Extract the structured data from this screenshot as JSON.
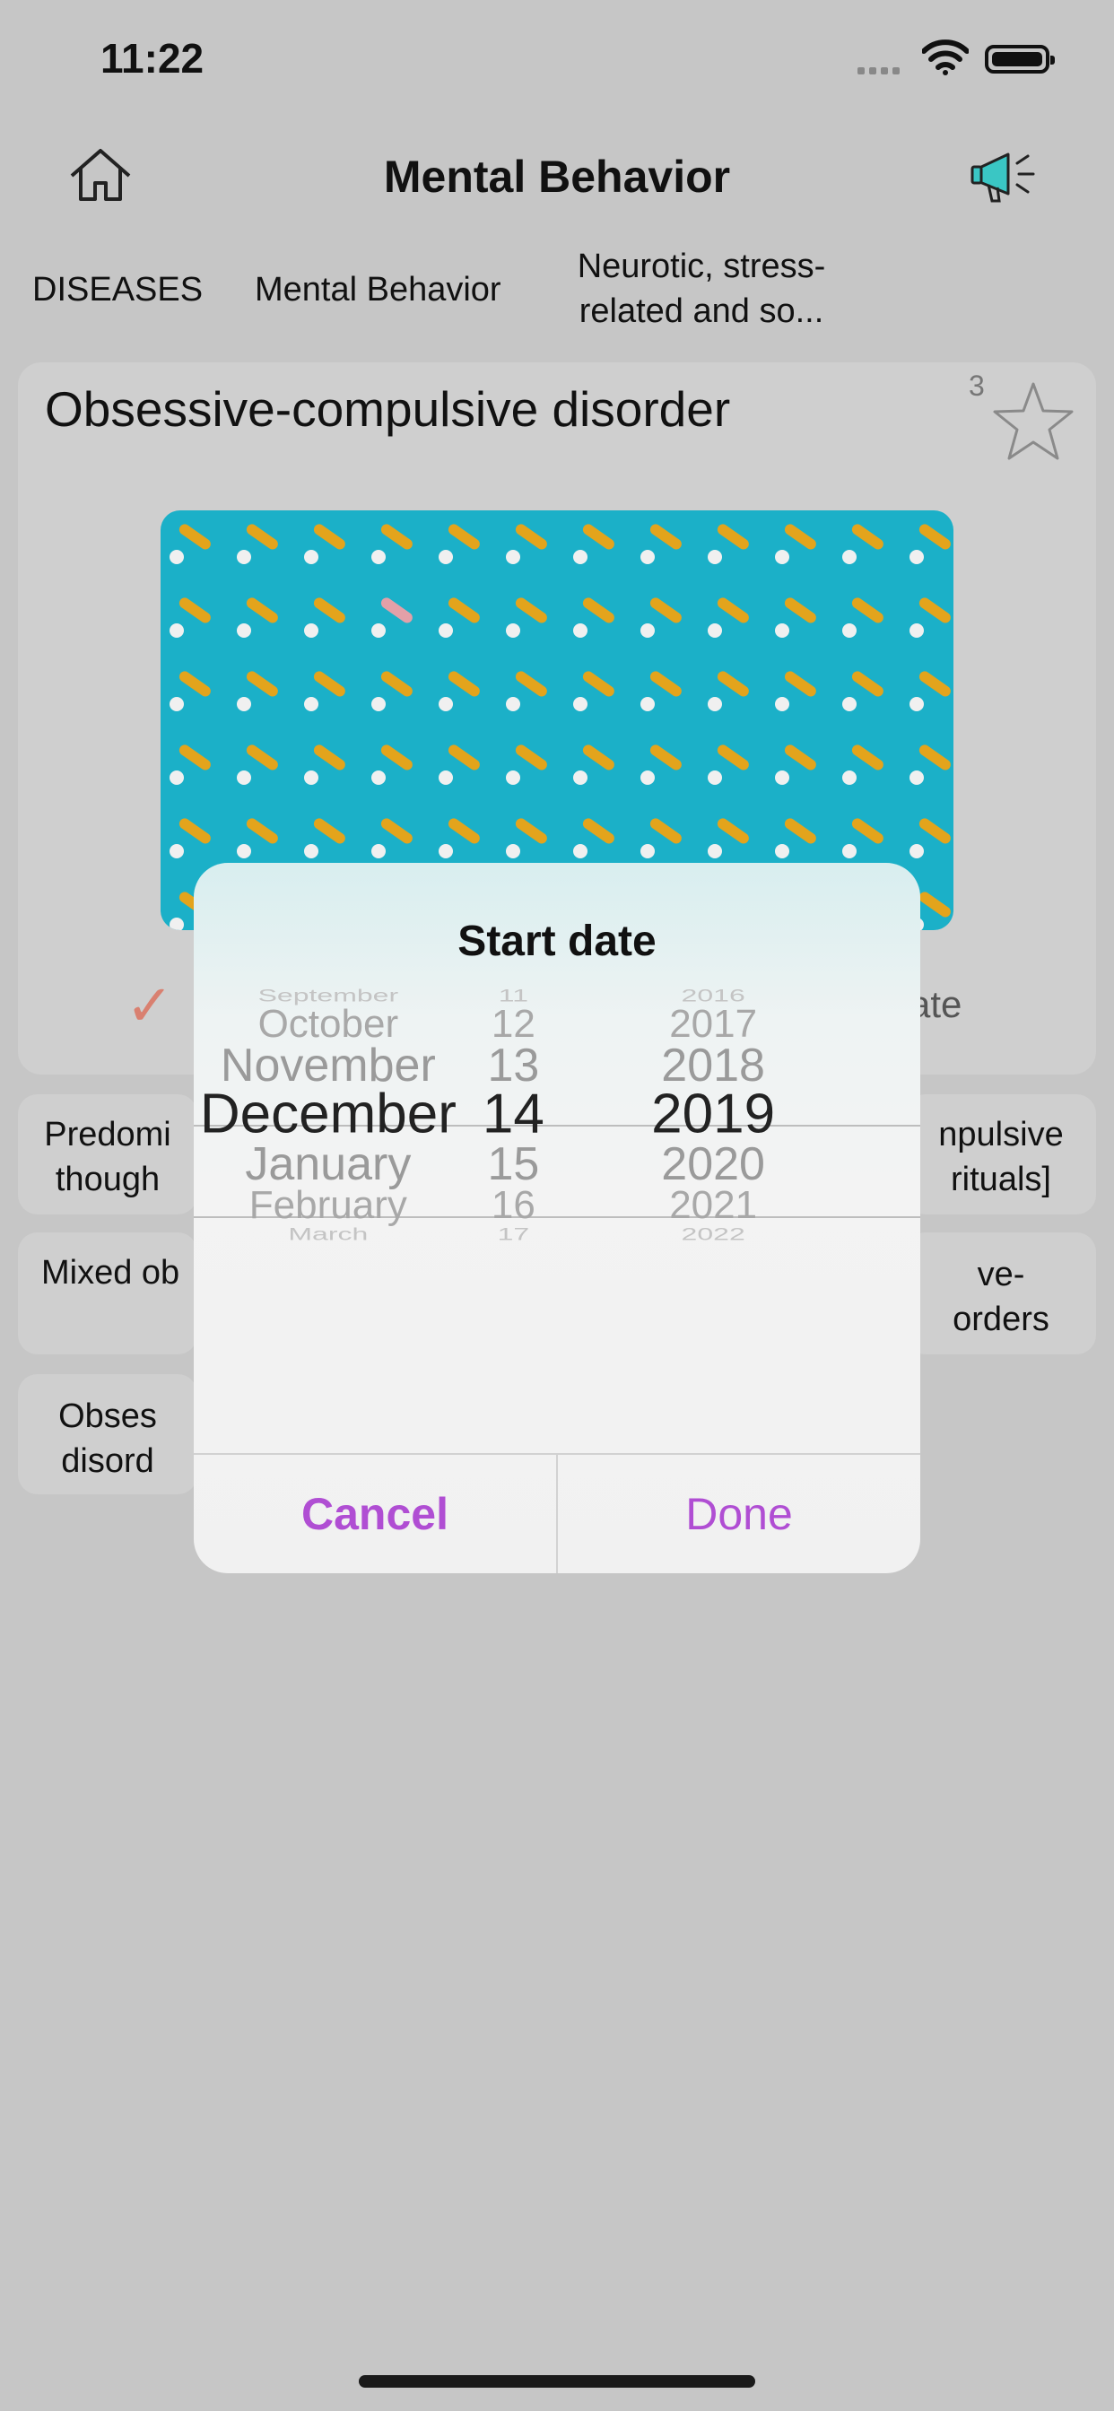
{
  "status_bar": {
    "time": "11:22"
  },
  "nav": {
    "title": "Mental Behavior",
    "home_icon": "home-icon",
    "announce_icon": "megaphone-icon"
  },
  "breadcrumbs": [
    "DISEASES",
    "Mental Behavior",
    "Neurotic, stress-\nrelated and so..."
  ],
  "card": {
    "title": "Obsessive-compulsive disorder",
    "count": "3",
    "star_icon": "star-icon",
    "check_icon": "check-icon",
    "date_peek": "ate"
  },
  "chips": [
    {
      "text": "Predomi\nthough"
    },
    {
      "text": "npulsive\nrituals]"
    },
    {
      "text": "Mixed ob"
    },
    {
      "text": "ve-\norders"
    },
    {
      "text": "Obses\ndisord"
    }
  ],
  "modal": {
    "title": "Start date",
    "months": [
      "September",
      "October",
      "November",
      "December",
      "January",
      "February",
      "March"
    ],
    "days": [
      "11",
      "12",
      "13",
      "14",
      "15",
      "16",
      "17"
    ],
    "years": [
      "2016",
      "2017",
      "2018",
      "2019",
      "2020",
      "2021",
      "2022"
    ],
    "selected": {
      "month": "December",
      "day": "14",
      "year": "2019"
    },
    "cancel_label": "Cancel",
    "done_label": "Done",
    "accent_color": "#b04ed3"
  }
}
